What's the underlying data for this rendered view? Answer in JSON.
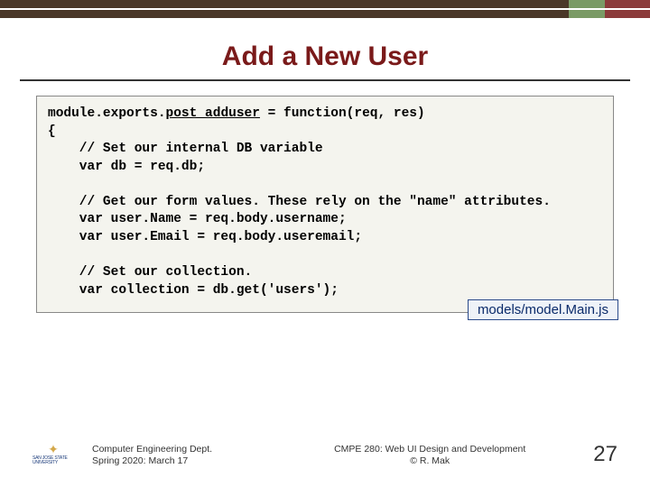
{
  "title": "Add a New User",
  "code": {
    "l1a": "module.exports.",
    "l1fn": "post_adduser",
    "l1b": " = function(req, res)",
    "l2": "{",
    "l3": "    // Set our internal DB variable",
    "l4": "    var db = req.db;",
    "blank1": " ",
    "l5": "    // Get our form values. These rely on the \"name\" attributes.",
    "l6": "    var user.Name = req.body.username;",
    "l7": "    var user.Email = req.body.useremail;",
    "blank2": " ",
    "l8": "    // Set our collection.",
    "l9": "    var collection = db.get('users');"
  },
  "pathlabel": "models/model.Main.js",
  "footer": {
    "logo_uname": "SAN JOSE STATE UNIVERSITY",
    "dept_l1": "Computer Engineering Dept.",
    "dept_l2": "Spring 2020: March 17",
    "course_l1": "CMPE 280: Web UI Design and Development",
    "course_l2": "© R. Mak",
    "page": "27"
  }
}
